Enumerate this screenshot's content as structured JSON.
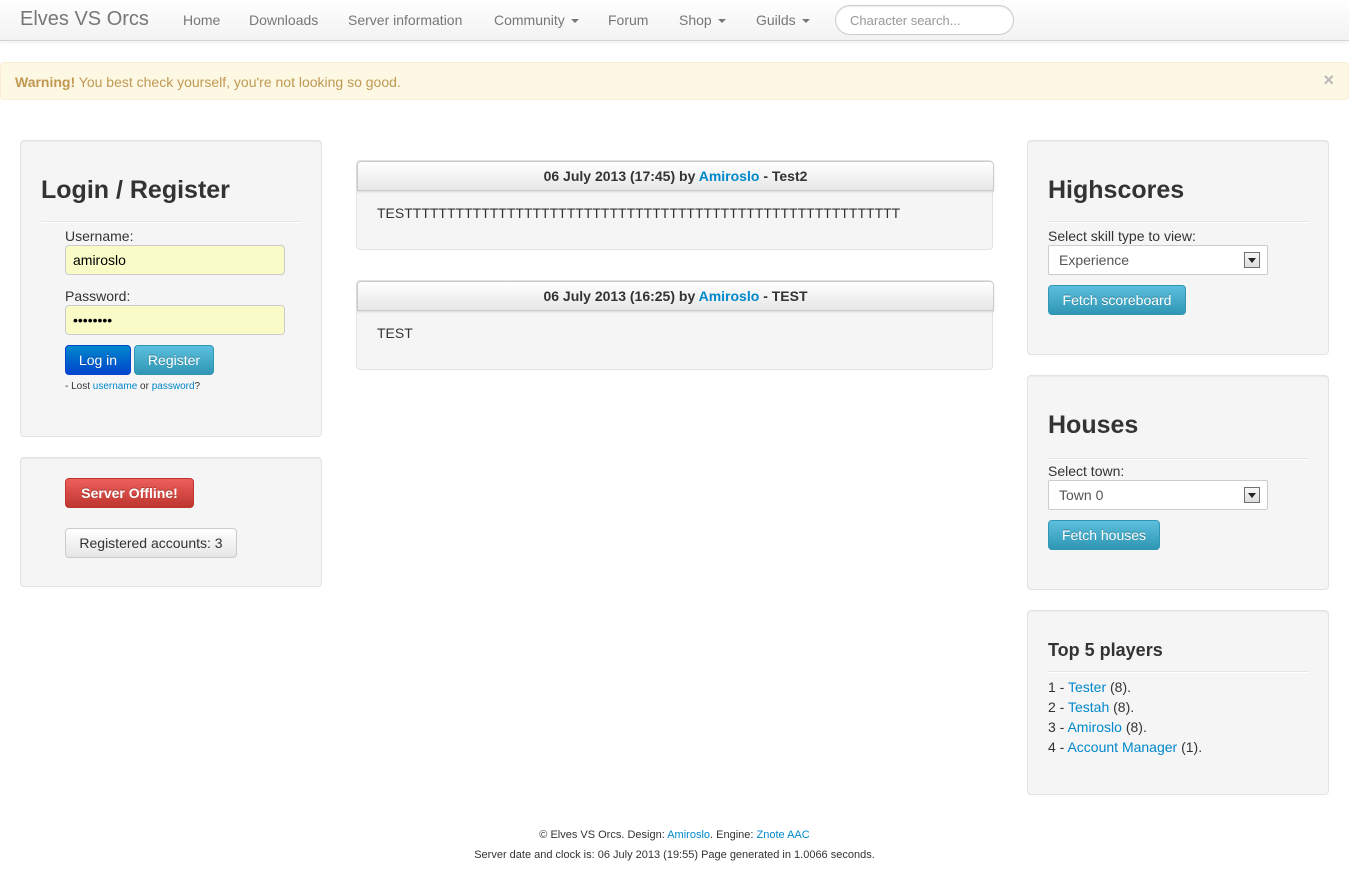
{
  "navbar": {
    "brand": "Elves VS Orcs",
    "items": [
      {
        "label": "Home"
      },
      {
        "label": "Downloads"
      },
      {
        "label": "Server information"
      },
      {
        "label": "Community"
      },
      {
        "label": "Forum"
      },
      {
        "label": "Shop"
      },
      {
        "label": "Guilds"
      }
    ],
    "search_placeholder": "Character search..."
  },
  "alert": {
    "strong": "Warning!",
    "message": "You best check yourself, you're not looking so good.",
    "close": "×"
  },
  "login": {
    "title": "Login / Register",
    "username_label": "Username:",
    "username_value": "amiroslo",
    "password_label": "Password:",
    "password_value": "••••••••",
    "login_button": "Log in",
    "register_button": "Register",
    "lost_prefix": "- Lost",
    "lost_username": "username",
    "lost_or": "or",
    "lost_password": "password",
    "lost_suffix": "?"
  },
  "server": {
    "status_button": "Server Offline!",
    "accounts_button": "Registered accounts: 3"
  },
  "news": [
    {
      "date": "06 July 2013 (17:45)",
      "by": "by",
      "author": "Amiroslo",
      "title": "- Test2",
      "body": "TESTTTTTTTTTTTTTTTTTTTTTTTTTTTTTTTTTTTTTTTTTTTTTTTTTTTTTTTTTT"
    },
    {
      "date": "06 July 2013 (16:25)",
      "by": "by",
      "author": "Amiroslo",
      "title": "- TEST",
      "body": "TEST"
    }
  ],
  "highscores": {
    "title": "Highscores",
    "select_label": "Select skill type to view:",
    "selected": "Experience",
    "button": "Fetch scoreboard"
  },
  "houses": {
    "title": "Houses",
    "select_label": "Select town:",
    "selected": "Town 0",
    "button": "Fetch houses"
  },
  "top_players": {
    "title": "Top 5 players",
    "players": [
      {
        "rank": "1 -",
        "name": "Tester",
        "level": "(8)."
      },
      {
        "rank": "2 -",
        "name": "Testah",
        "level": "(8)."
      },
      {
        "rank": "3 -",
        "name": "Amiroslo",
        "level": "(8)."
      },
      {
        "rank": "4 -",
        "name": "Account Manager",
        "level": "(1)."
      }
    ]
  },
  "footer": {
    "copyright": "© Elves VS Orcs. Design:",
    "designer": "Amiroslo",
    "engine_label": ". Engine:",
    "engine": "Znote AAC",
    "clock": "Server date and clock is: 06 July 2013 (19:55) Page generated in 1.0066 seconds."
  },
  "colors": {
    "link": "#0088cc",
    "alert_bg": "#fcf8e3",
    "alert_text": "#c09853",
    "primary": "#0044cc",
    "info": "#2f96b4",
    "danger": "#bd362f"
  }
}
